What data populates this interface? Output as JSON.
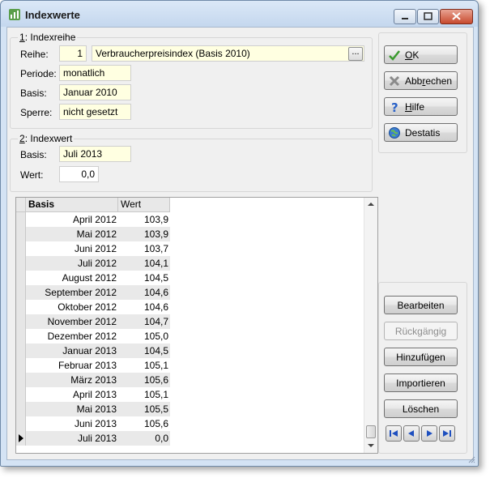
{
  "window": {
    "title": "Indexwerte"
  },
  "group_index_series": {
    "title_prefix": "1",
    "title_rest": ": Indexreihe",
    "reihe_label": "Reihe:",
    "reihe_number": "1",
    "reihe_name": "Verbraucherpreisindex (Basis 2010)",
    "browse_label": "...",
    "periode_label": "Periode:",
    "periode_value": "monatlich",
    "basis_label": "Basis:",
    "basis_value": "Januar 2010",
    "sperre_label": "Sperre:",
    "sperre_value": "nicht gesetzt"
  },
  "group_index_value": {
    "title_prefix": "2",
    "title_rest": ": Indexwert",
    "basis_label": "Basis:",
    "basis_value": "Juli 2013",
    "wert_label": "Wert:",
    "wert_value": "0,0"
  },
  "grid": {
    "columns": [
      "Basis",
      "Wert"
    ],
    "rows": [
      {
        "basis": "April 2012",
        "wert": "103,9"
      },
      {
        "basis": "Mai 2012",
        "wert": "103,9"
      },
      {
        "basis": "Juni 2012",
        "wert": "103,7"
      },
      {
        "basis": "Juli 2012",
        "wert": "104,1"
      },
      {
        "basis": "August 2012",
        "wert": "104,5"
      },
      {
        "basis": "September 2012",
        "wert": "104,6"
      },
      {
        "basis": "Oktober 2012",
        "wert": "104,6"
      },
      {
        "basis": "November 2012",
        "wert": "104,7"
      },
      {
        "basis": "Dezember 2012",
        "wert": "105,0"
      },
      {
        "basis": "Januar 2013",
        "wert": "104,5"
      },
      {
        "basis": "Februar 2013",
        "wert": "105,1"
      },
      {
        "basis": "März 2013",
        "wert": "105,6"
      },
      {
        "basis": "April 2013",
        "wert": "105,1"
      },
      {
        "basis": "Mai 2013",
        "wert": "105,5"
      },
      {
        "basis": "Juni 2013",
        "wert": "105,6"
      },
      {
        "basis": "Juli 2013",
        "wert": "0,0"
      }
    ]
  },
  "buttons_top": {
    "ok": {
      "pre": "",
      "key": "O",
      "post": "K",
      "icon": "checkmark-icon"
    },
    "abbrechen": {
      "pre": "Abb",
      "key": "r",
      "post": "echen",
      "icon": "cross-icon"
    },
    "hilfe": {
      "pre": "",
      "key": "H",
      "post": "ilfe",
      "icon": "help-icon"
    },
    "destatis": {
      "pre": "Destatis",
      "key": "",
      "post": "",
      "icon": "globe-icon"
    }
  },
  "buttons_bottom": {
    "bearbeiten": "Bearbeiten",
    "rueckgaengig": "Rückgängig",
    "hinzufuegen": "Hinzufügen",
    "importieren": "Importieren",
    "loeschen": "Löschen"
  },
  "colors": {
    "field_bg": "#ffffe1",
    "check_green": "#3a9a2e",
    "help_blue": "#2a62c8",
    "nav_blue": "#1e4fbf"
  }
}
